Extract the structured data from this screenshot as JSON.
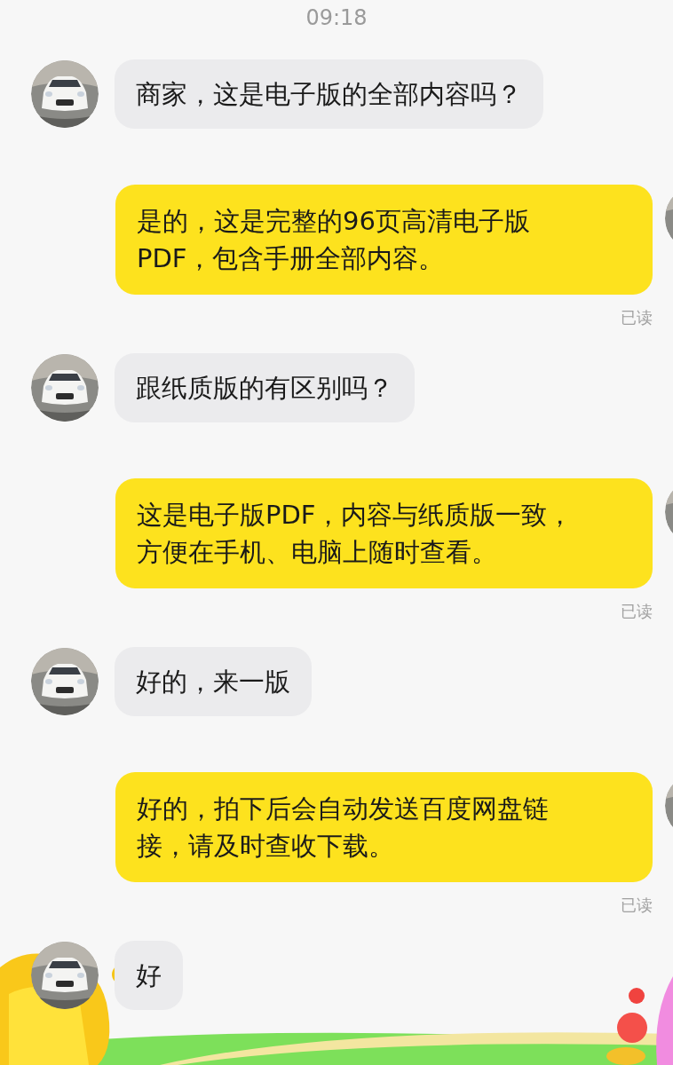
{
  "timestamp": "09:18",
  "messages": [
    {
      "kind": "incoming",
      "text": "商家，这是电子版的全部内容吗？"
    },
    {
      "kind": "outgoing",
      "text": "是的，这是完整的96页高清电子版PDF，包含手册全部内容。",
      "receipt": "已读"
    },
    {
      "kind": "incoming",
      "text": "跟纸质版的有区别吗？"
    },
    {
      "kind": "outgoing",
      "text": "这是电子版PDF，内容与纸质版一致，方便在手机、电脑上随时查看。",
      "receipt": "已读"
    },
    {
      "kind": "incoming",
      "text": "好的，来一版"
    },
    {
      "kind": "outgoing",
      "text": "好的，拍下后会自动发送百度网盘链接，请及时查收下载。",
      "receipt": "已读"
    },
    {
      "kind": "incoming",
      "text": "好"
    }
  ]
}
